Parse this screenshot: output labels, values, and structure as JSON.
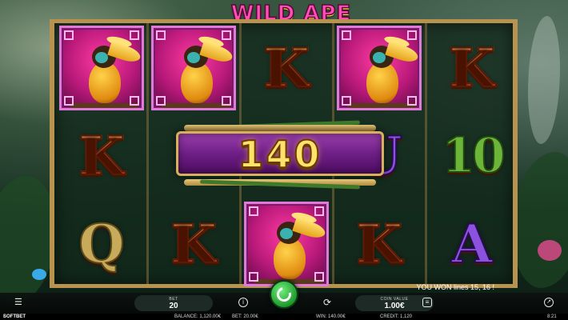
{
  "game": {
    "title": "WILD APE",
    "win_amount": "140",
    "win_message": "YOU WON lines 15, 16 !"
  },
  "reels": [
    [
      "bird",
      "K",
      "Q"
    ],
    [
      "bird",
      "",
      "K"
    ],
    [
      "K",
      "",
      "bird"
    ],
    [
      "bird",
      "U",
      "K"
    ],
    [
      "K",
      "10",
      "A"
    ]
  ],
  "controls": {
    "bet_label": "BET",
    "bet_value": "20",
    "coin_value_label": "COIN VALUE",
    "coin_value": "1.00€",
    "menu_icon": "menu-icon",
    "info_icon": "info-icon",
    "spin_icon": "spin-icon",
    "autoplay_icon": "autoplay-icon",
    "coins_icon": "coins-icon",
    "fullscreen_icon": "fullscreen-icon"
  },
  "status": {
    "brand_prefix": "i",
    "brand_name": "SOFTBET",
    "balance": "BALANCE: 1,120.00€",
    "bet": "BET: 20.00€",
    "win": "WIN: 140.00€",
    "credit": "CREDIT: 1,120",
    "time": "8:21"
  }
}
